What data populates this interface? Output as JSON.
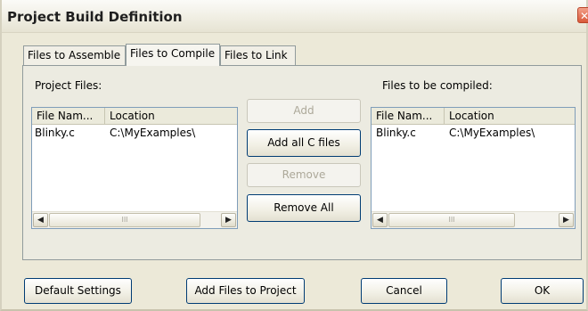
{
  "window": {
    "title": "Project Build Definition",
    "close_glyph": "✕"
  },
  "tabs": [
    {
      "label": "Files to Assemble"
    },
    {
      "label": "Files to Compile"
    },
    {
      "label": "Files to Link"
    }
  ],
  "project_files": {
    "label": "Project Files:",
    "columns": [
      "File Nam...",
      "Location"
    ],
    "rows": [
      {
        "name": "Blinky.c",
        "location": "C:\\MyExamples\\"
      }
    ]
  },
  "compiled_files": {
    "label": "Files to be compiled:",
    "columns": [
      "File Nam...",
      "Location"
    ],
    "rows": [
      {
        "name": "Blinky.c",
        "location": "C:\\MyExamples\\"
      }
    ]
  },
  "scrollbar": {
    "left_glyph": "◀",
    "right_glyph": "▶",
    "grip_glyph": "III"
  },
  "middle_buttons": {
    "add": "Add",
    "add_all_c": "Add all C files",
    "remove": "Remove",
    "remove_all": "Remove All"
  },
  "bottom_buttons": {
    "default_settings": "Default Settings",
    "add_files_to_project": "Add Files to Project",
    "cancel": "Cancel",
    "ok": "OK"
  }
}
